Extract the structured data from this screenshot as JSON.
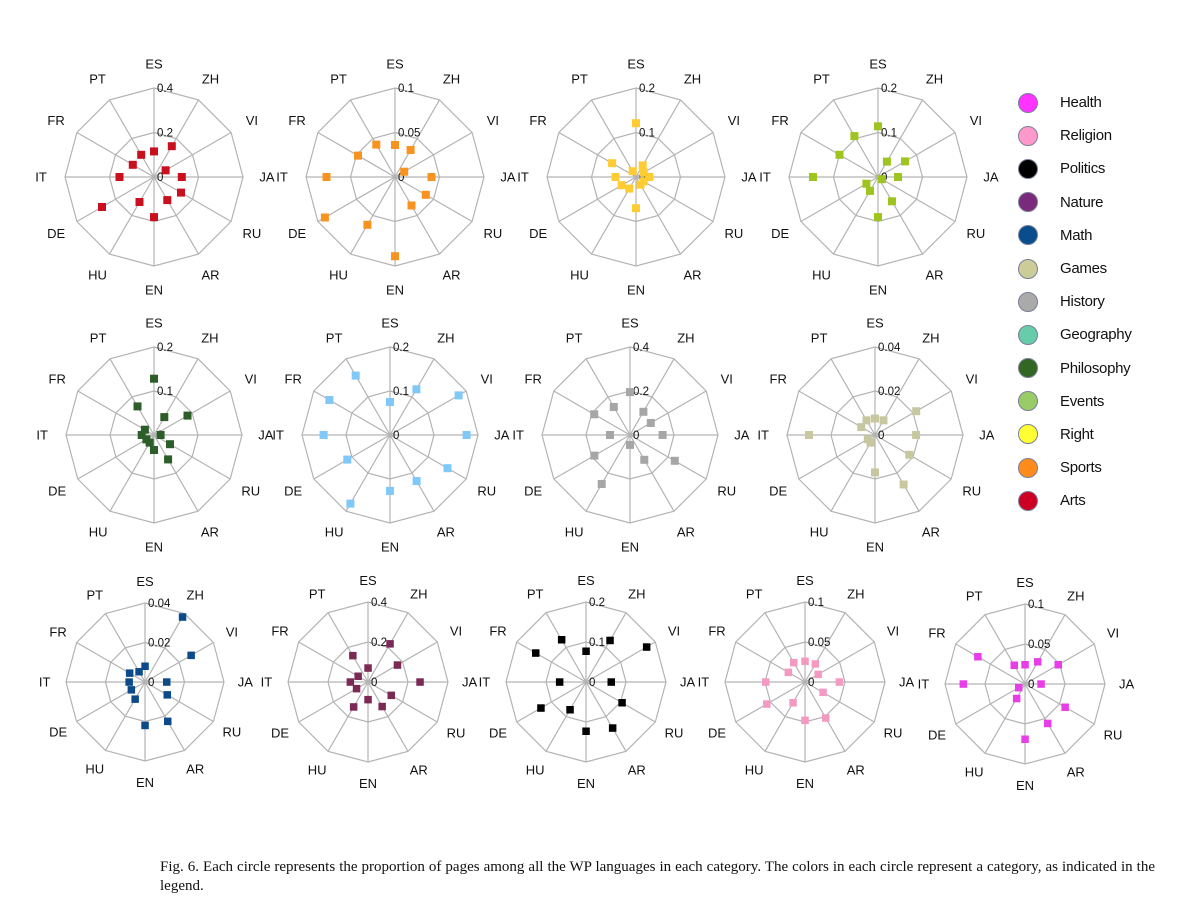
{
  "legend": [
    {
      "label": "Health",
      "color": "#ff33ff"
    },
    {
      "label": "Religion",
      "color": "#ff99cc"
    },
    {
      "label": "Politics",
      "color": "#000000"
    },
    {
      "label": "Nature",
      "color": "#7a2a7a"
    },
    {
      "label": "Math",
      "color": "#0a4d8c"
    },
    {
      "label": "Games",
      "color": "#cccc99"
    },
    {
      "label": "History",
      "color": "#aaaaaa"
    },
    {
      "label": "Geography",
      "color": "#66ccaa"
    },
    {
      "label": "Philosophy",
      "color": "#336622"
    },
    {
      "label": "Events",
      "color": "#99cc66"
    },
    {
      "label": "Right",
      "color": "#ffff33"
    },
    {
      "label": "Sports",
      "color": "#ff8c1a"
    },
    {
      "label": "Arts",
      "color": "#cc0022"
    }
  ],
  "caption": "Fig. 6.  Each circle represents the proportion of pages among all the WP languages in each category. The colors in each circle represent a category, as indicated in the legend.",
  "chart_data": [
    {
      "type": "radar",
      "name": "Arts",
      "color": "#c8101e",
      "axes": [
        "ES",
        "ZH",
        "VI",
        "JA",
        "RU",
        "AR",
        "EN",
        "HU",
        "DE",
        "IT",
        "FR",
        "PT"
      ],
      "rmax": 0.4,
      "ticks": [
        "0",
        "0.2",
        "0.4"
      ],
      "grid": true,
      "values": [
        0.115,
        0.16,
        0.06,
        0.125,
        0.14,
        0.12,
        0.18,
        0.13,
        0.27,
        0.155,
        0.11,
        0.115
      ]
    },
    {
      "type": "radar",
      "name": "Sports",
      "color": "#f7931e",
      "axes": [
        "ES",
        "ZH",
        "VI",
        "JA",
        "RU",
        "AR",
        "EN",
        "HU",
        "DE",
        "IT",
        "FR",
        "PT"
      ],
      "rmax": 0.1,
      "ticks": [
        "0",
        "0.05",
        "0.1"
      ],
      "grid": true,
      "values": [
        0.036,
        0.035,
        0.012,
        0.041,
        0.04,
        0.037,
        0.089,
        0.062,
        0.091,
        0.077,
        0.048,
        0.042
      ]
    },
    {
      "type": "radar",
      "name": "Right",
      "color": "#ffcc33",
      "axes": [
        "ES",
        "ZH",
        "VI",
        "JA",
        "RU",
        "AR",
        "EN",
        "HU",
        "DE",
        "IT",
        "FR",
        "PT"
      ],
      "rmax": 0.2,
      "ticks": [
        "0",
        "0.1",
        "0.2"
      ],
      "grid": true,
      "values": [
        0.121,
        0.03,
        0.02,
        0.03,
        0.02,
        0.02,
        0.07,
        0.03,
        0.037,
        0.046,
        0.062,
        0.015
      ]
    },
    {
      "type": "radar",
      "name": "Events",
      "color": "#9dc41f",
      "axes": [
        "ES",
        "ZH",
        "VI",
        "JA",
        "RU",
        "AR",
        "EN",
        "HU",
        "DE",
        "IT",
        "FR",
        "PT"
      ],
      "rmax": 0.2,
      "ticks": [
        "0",
        "0.1",
        "0.2"
      ],
      "grid": true,
      "values": [
        0.114,
        0.04,
        0.07,
        0.045,
        0.01,
        0.063,
        0.09,
        0.036,
        0.03,
        0.146,
        0.1,
        0.106
      ]
    },
    {
      "type": "radar",
      "name": "Philosophy",
      "color": "#2d5e2a",
      "axes": [
        "ES",
        "ZH",
        "VI",
        "JA",
        "RU",
        "AR",
        "EN",
        "HU",
        "DE",
        "IT",
        "FR",
        "PT"
      ],
      "rmax": 0.2,
      "ticks": [
        "0",
        "0.1",
        "0.2"
      ],
      "grid": true,
      "values": [
        0.128,
        0.047,
        0.088,
        0.015,
        0.042,
        0.064,
        0.034,
        0.02,
        0.02,
        0.028,
        0.024,
        0.075
      ]
    },
    {
      "type": "radar",
      "name": "Geography",
      "color": "#7fc8f8",
      "axes": [
        "ES",
        "ZH",
        "VI",
        "JA",
        "RU",
        "AR",
        "EN",
        "HU",
        "DE",
        "IT",
        "FR",
        "PT"
      ],
      "rmax": 0.2,
      "ticks": [
        "0",
        "0.1",
        "0.2"
      ],
      "grid": true,
      "values": [
        0.075,
        0.12,
        0.18,
        0.174,
        0.151,
        0.121,
        0.127,
        0.18,
        0.112,
        0.151,
        0.159,
        0.156
      ]
    },
    {
      "type": "radar",
      "name": "History",
      "color": "#a6a6a6",
      "axes": [
        "ES",
        "ZH",
        "VI",
        "JA",
        "RU",
        "AR",
        "EN",
        "HU",
        "DE",
        "IT",
        "FR",
        "PT"
      ],
      "rmax": 0.4,
      "ticks": [
        "0",
        "0.2",
        "0.4"
      ],
      "grid": true,
      "values": [
        0.195,
        0.122,
        0.109,
        0.148,
        0.235,
        0.13,
        0.045,
        0.257,
        0.187,
        0.091,
        0.188,
        0.147
      ]
    },
    {
      "type": "radar",
      "name": "Games",
      "color": "#c8c8a0",
      "axes": [
        "ES",
        "ZH",
        "VI",
        "JA",
        "RU",
        "AR",
        "EN",
        "HU",
        "DE",
        "IT",
        "FR",
        "PT"
      ],
      "rmax": 0.04,
      "ticks": [
        "0",
        "0.02",
        "0.04"
      ],
      "grid": true,
      "values": [
        0.0075,
        0.0077,
        0.0216,
        0.0187,
        0.018,
        0.026,
        0.017,
        0.004,
        0.0038,
        0.03,
        0.0072,
        0.0077
      ]
    },
    {
      "type": "radar",
      "name": "Math",
      "color": "#0d4a8a",
      "axes": [
        "ES",
        "ZH",
        "VI",
        "JA",
        "RU",
        "AR",
        "EN",
        "HU",
        "DE",
        "IT",
        "FR",
        "PT"
      ],
      "rmax": 0.04,
      "ticks": [
        "0",
        "0.02",
        "0.04"
      ],
      "grid": true,
      "values": [
        0.008,
        0.038,
        0.027,
        0.011,
        0.013,
        0.023,
        0.022,
        0.01,
        0.008,
        0.008,
        0.009,
        0.006
      ]
    },
    {
      "type": "radar",
      "name": "Nature",
      "color": "#7b2a55",
      "axes": [
        "ES",
        "ZH",
        "VI",
        "JA",
        "RU",
        "AR",
        "EN",
        "HU",
        "DE",
        "IT",
        "FR",
        "PT"
      ],
      "rmax": 0.4,
      "ticks": [
        "0",
        "0.2",
        "0.4"
      ],
      "grid": true,
      "values": [
        0.07,
        0.22,
        0.17,
        0.26,
        0.134,
        0.142,
        0.088,
        0.144,
        0.066,
        0.088,
        0.057,
        0.152
      ]
    },
    {
      "type": "radar",
      "name": "Politics",
      "color": "#000000",
      "axes": [
        "ES",
        "ZH",
        "VI",
        "JA",
        "RU",
        "AR",
        "EN",
        "HU",
        "DE",
        "IT",
        "FR",
        "PT"
      ],
      "rmax": 0.2,
      "ticks": [
        "0",
        "0.1",
        "0.2"
      ],
      "grid": true,
      "values": [
        0.077,
        0.12,
        0.175,
        0.063,
        0.104,
        0.133,
        0.123,
        0.08,
        0.13,
        0.066,
        0.145,
        0.122
      ]
    },
    {
      "type": "radar",
      "name": "Religion",
      "color": "#f49ac2",
      "axes": [
        "ES",
        "ZH",
        "VI",
        "JA",
        "RU",
        "AR",
        "EN",
        "HU",
        "DE",
        "IT",
        "FR",
        "PT"
      ],
      "rmax": 0.1,
      "ticks": [
        "0",
        "0.05",
        "0.1"
      ],
      "grid": true,
      "values": [
        0.026,
        0.026,
        0.019,
        0.043,
        0.026,
        0.052,
        0.048,
        0.03,
        0.055,
        0.049,
        0.024,
        0.028
      ]
    },
    {
      "type": "radar",
      "name": "Health",
      "color": "#e83ee8",
      "axes": [
        "ES",
        "ZH",
        "VI",
        "JA",
        "RU",
        "AR",
        "EN",
        "HU",
        "DE",
        "IT",
        "FR",
        "PT"
      ],
      "rmax": 0.1,
      "ticks": [
        "0",
        "0.05",
        "0.1"
      ],
      "grid": true,
      "values": [
        0.024,
        0.032,
        0.048,
        0.02,
        0.058,
        0.057,
        0.069,
        0.021,
        0.009,
        0.077,
        0.068,
        0.027
      ]
    }
  ]
}
